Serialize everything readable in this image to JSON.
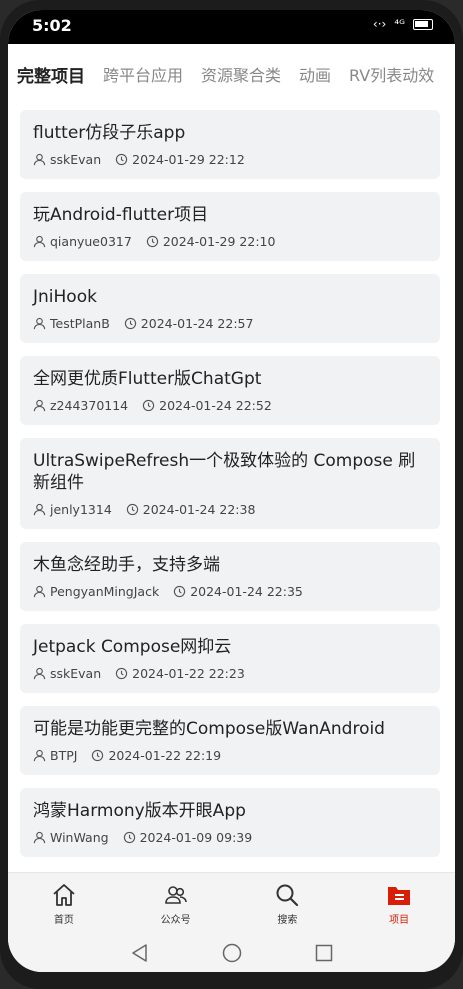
{
  "status": {
    "time": "5:02",
    "network": "⁴ᴳ"
  },
  "tabs": [
    "完整项目",
    "跨平台应用",
    "资源聚合类",
    "动画",
    "RV列表动效"
  ],
  "items": [
    {
      "title": "flutter仿段子乐app",
      "author": "sskEvan",
      "date": "2024-01-29 22:12"
    },
    {
      "title": "玩Android-flutter项目",
      "author": "qianyue0317",
      "date": "2024-01-29 22:10"
    },
    {
      "title": "JniHook",
      "author": "TestPlanB",
      "date": "2024-01-24 22:57"
    },
    {
      "title": "全网更优质Flutter版ChatGpt",
      "author": "z244370114",
      "date": "2024-01-24 22:52"
    },
    {
      "title": "UltraSwipeRefresh一个极致体验的 Compose 刷新组件",
      "author": "jenly1314",
      "date": "2024-01-24 22:38"
    },
    {
      "title": "木鱼念经助手，支持多端",
      "author": "PengyanMingJack",
      "date": "2024-01-24 22:35"
    },
    {
      "title": "Jetpack Compose网抑云",
      "author": "sskEvan",
      "date": "2024-01-22 22:23"
    },
    {
      "title": "可能是功能更完整的Compose版WanAndroid",
      "author": "BTPJ",
      "date": "2024-01-22 22:19"
    },
    {
      "title": "鸿蒙Harmony版本开眼App",
      "author": "WinWang",
      "date": "2024-01-09 09:39"
    }
  ],
  "nav": {
    "home": "首页",
    "wechat": "公众号",
    "search": "搜索",
    "project": "项目"
  },
  "colors": {
    "accent": "#d81e06",
    "card": "#f1f2f4"
  }
}
